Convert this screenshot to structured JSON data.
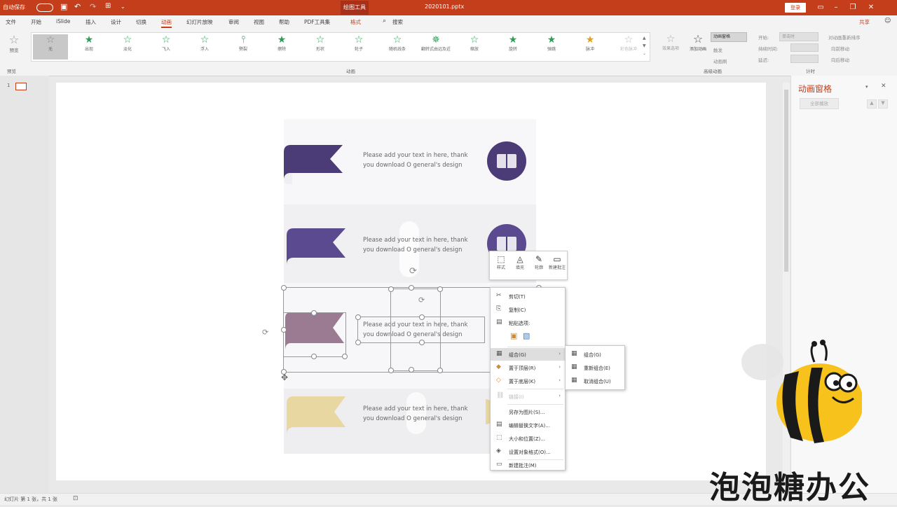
{
  "titlebar": {
    "autosave": "自动保存",
    "filename": "2020101.pptx",
    "context_tab": "绘图工具",
    "login": "登录"
  },
  "menu": {
    "tabs": [
      "文件",
      "开始",
      "iSlide",
      "插入",
      "设计",
      "切换",
      "动画",
      "幻灯片放映",
      "审阅",
      "视图",
      "帮助",
      "PDF工具集",
      "格式"
    ],
    "active": "动画",
    "search": "搜索",
    "share": "共享"
  },
  "ribbon": {
    "preview": "预览",
    "effects": [
      {
        "label": "无",
        "selected": true
      },
      {
        "label": "出现"
      },
      {
        "label": "淡化"
      },
      {
        "label": "飞入"
      },
      {
        "label": "浮入"
      },
      {
        "label": "劈裂"
      },
      {
        "label": "擦除"
      },
      {
        "label": "形状"
      },
      {
        "label": "轮子"
      },
      {
        "label": "随机线条"
      },
      {
        "label": "翻转式由远及近"
      },
      {
        "label": "缩放"
      },
      {
        "label": "旋转"
      },
      {
        "label": "弹跳"
      },
      {
        "label": "脉冲",
        "accent": true
      },
      {
        "label": "彩色脉冲",
        "dim": true
      }
    ],
    "effect_options": "效果选项",
    "group_preview": "预览",
    "group_animation": "动画",
    "add_animation": "添加动画",
    "animation_pane": "动画窗格",
    "trigger": "触发",
    "animation_painter": "动画刷",
    "group_advanced": "高级动画",
    "start": "开始:",
    "start_value": "单击时",
    "duration": "持续时间:",
    "delay": "延迟:",
    "reorder": "对动画重新排序",
    "move_earlier": "向前移动",
    "move_later": "向后移动",
    "group_timing": "计时"
  },
  "slide": {
    "text_line1": "Please add your text in here, thank",
    "text_line2": "you download O general's design",
    "colors": {
      "purple_dark": "#4b3b77",
      "purple": "#5b4a8f",
      "mauve": "#9b7b92",
      "sand": "#e8d7a1"
    }
  },
  "minibar": {
    "items": [
      "样式",
      "填充",
      "轮廓",
      "新建批注"
    ]
  },
  "context_menu": {
    "items": [
      {
        "icon": "✂",
        "label": "剪切(T)"
      },
      {
        "icon": "⎘",
        "label": "复制(C)"
      },
      {
        "icon": "📋",
        "label": "粘贴选项:"
      },
      {
        "icon": "",
        "label": ""
      },
      {
        "icon": "▦",
        "label": "组合(G)",
        "arrow": true,
        "highlight": true
      },
      {
        "icon": "◆",
        "label": "置于顶层(R)",
        "arrow": true
      },
      {
        "icon": "◇",
        "label": "置于底层(K)",
        "arrow": true
      },
      {
        "icon": "🔗",
        "label": "链接(I)",
        "arrow": true,
        "disabled": true
      },
      {
        "icon": "",
        "label": "另存为图片(S)..."
      },
      {
        "icon": "▤",
        "label": "编辑替换文字(A)..."
      },
      {
        "icon": "⬚",
        "label": "大小和位置(Z)..."
      },
      {
        "icon": "◈",
        "label": "设置对象格式(O)..."
      },
      {
        "icon": "💬",
        "label": "新建批注(M)"
      }
    ],
    "submenu": [
      {
        "icon": "▦",
        "label": "组合(G)"
      },
      {
        "icon": "▦",
        "label": "重新组合(E)"
      },
      {
        "icon": "▦",
        "label": "取消组合(U)"
      }
    ]
  },
  "animation_pane": {
    "title": "动画窗格",
    "play": "全部播放"
  },
  "status": {
    "slide_info": "幻灯片 第 1 张，共 1 张"
  },
  "watermark": "泡泡糖办公"
}
